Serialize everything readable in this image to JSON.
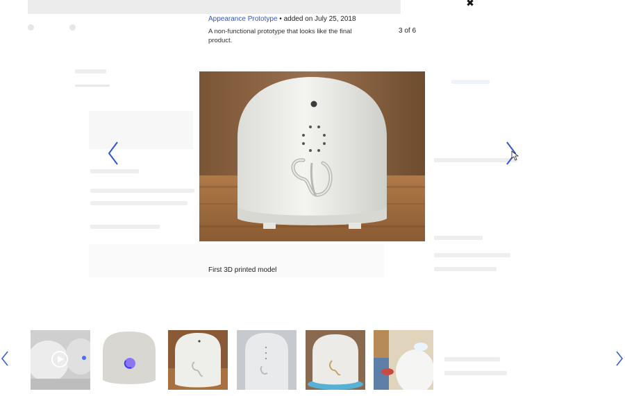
{
  "lightbox": {
    "category_link": "Appearance Prototype",
    "added_text": " • added on July 25, 2018",
    "description": "A non-functional prototype that looks like the final product.",
    "counter": "3 of 6",
    "caption": "First 3D printed model",
    "close_icon": "close-icon",
    "accent_color": "#2f55d4"
  },
  "thumbnails": [
    {
      "name": "thumbnail-video",
      "icon": "play-icon"
    },
    {
      "name": "thumbnail-lit-device"
    },
    {
      "name": "thumbnail-3d-printed-model",
      "selected": true
    },
    {
      "name": "thumbnail-grey-device"
    },
    {
      "name": "thumbnail-glowing-device"
    },
    {
      "name": "thumbnail-child-with-device"
    }
  ]
}
